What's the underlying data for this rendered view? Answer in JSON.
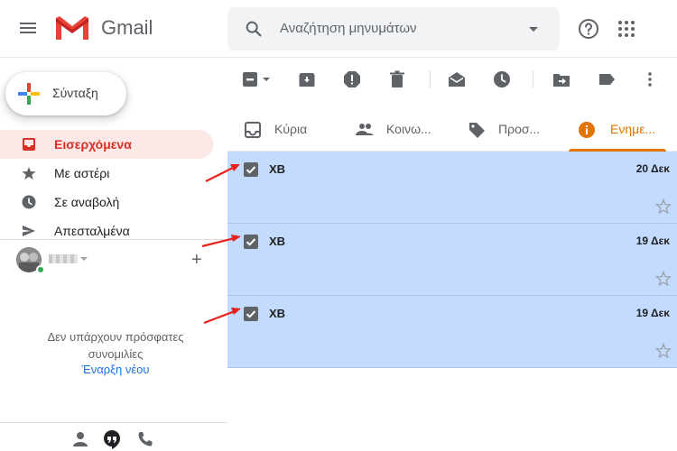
{
  "header": {
    "app_name": "Gmail",
    "search_placeholder": "Αναζήτηση μηνυμάτων"
  },
  "sidebar": {
    "compose_label": "Σύνταξη",
    "items": [
      {
        "label": "Εισερχόμενα",
        "icon": "inbox-icon",
        "active": true
      },
      {
        "label": "Με αστέρι",
        "icon": "star-icon",
        "active": false
      },
      {
        "label": "Σε αναβολή",
        "icon": "clock-icon",
        "active": false
      },
      {
        "label": "Απεσταλμένα",
        "icon": "send-icon",
        "active": false
      }
    ],
    "hangouts": {
      "no_chats_line1": "Δεν υπάρχουν πρόσφατες",
      "no_chats_line2": "συνομιλίες",
      "new_chat_link": "Έναρξη νέου"
    }
  },
  "tabs": [
    {
      "label": "Κύρια",
      "icon": "inbox-tab-icon",
      "active": false
    },
    {
      "label": "Κοινω...",
      "icon": "people-icon",
      "active": false
    },
    {
      "label": "Προσ...",
      "icon": "tag-icon",
      "active": false
    },
    {
      "label": "Ενημε...",
      "icon": "info-icon",
      "active": true
    }
  ],
  "emails": [
    {
      "sender": "XB",
      "date": "20 Δεκ",
      "selected": true
    },
    {
      "sender": "XB",
      "date": "19 Δεκ",
      "selected": true
    },
    {
      "sender": "XB",
      "date": "19 Δεκ",
      "selected": true
    }
  ],
  "colors": {
    "accent_red": "#d93025",
    "tab_orange": "#e37400",
    "selected_row": "#c2dbff",
    "annotation_arrow": "#e8221b"
  }
}
